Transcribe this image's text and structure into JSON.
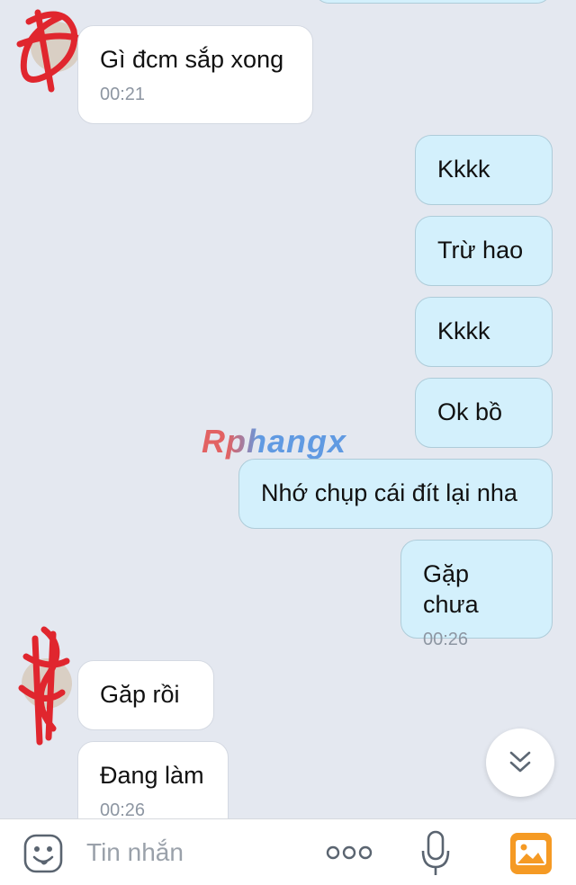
{
  "messages": [
    {
      "side": "in",
      "text": "Gì đcm sắp xong",
      "time": "00:21"
    },
    {
      "side": "out",
      "text": "Kkkk"
    },
    {
      "side": "out",
      "text": "Trừ hao"
    },
    {
      "side": "out",
      "text": "Kkkk"
    },
    {
      "side": "out",
      "text": "Ok bồ"
    },
    {
      "side": "out",
      "text": "Nhớ chụp cái đít lại nha"
    },
    {
      "side": "out",
      "text": "Gặp chưa",
      "time": "00:26"
    },
    {
      "side": "in",
      "text": "Găp rồi"
    },
    {
      "side": "in",
      "text": "Đang làm",
      "time": "00:26"
    }
  ],
  "watermark": "Rphangx",
  "input": {
    "placeholder": "Tin nhắn",
    "icons": [
      "sticker-icon",
      "more-icon",
      "microphone-icon",
      "image-icon"
    ]
  },
  "colors": {
    "background": "#e4e8f0",
    "incoming_bubble": "#ffffff",
    "outgoing_bubble": "#d3f0fc",
    "timestamp": "#8d96a2",
    "image_icon": "#f59a24"
  }
}
